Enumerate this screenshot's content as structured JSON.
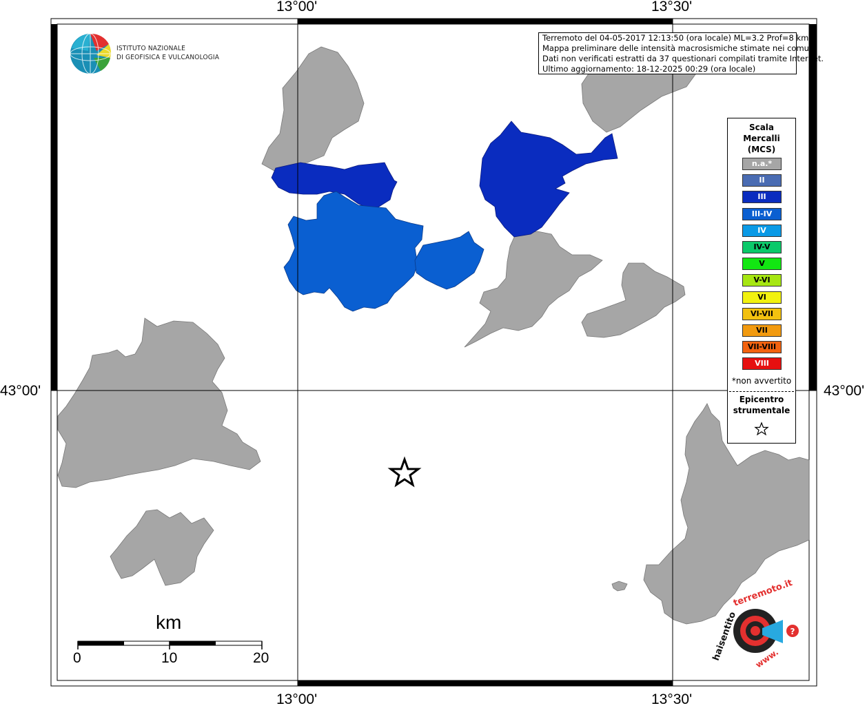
{
  "coordinates": {
    "lon_top_left": "13°00'",
    "lon_top_right": "13°30'",
    "lon_bottom_left": "13°00'",
    "lon_bottom_right": "13°30'",
    "lat_left": "43°00'",
    "lat_right": "43°00'"
  },
  "info": {
    "line1": "Terremoto del 04-05-2017 12:13:50 (ora locale) ML=3.2 Prof=8 km",
    "line2": "Mappa preliminare delle intensità macrosismiche stimate nei comuni",
    "line3": "Dati non verificati estratti da 37 questionari compilati tramite Internet.",
    "line4": "Ultimo aggiornamento: 18-12-2025 00:29 (ora locale)"
  },
  "logo": {
    "line1": "ISTITUTO NAZIONALE",
    "line2": "DI GEOFISICA E VULCANOLOGIA"
  },
  "legend": {
    "title_line1": "Scala",
    "title_line2": "Mercalli",
    "title_line3": "(MCS)",
    "items": [
      {
        "label": "n.a.*",
        "color": "#a6a6a6"
      },
      {
        "label": "II",
        "color": "#4a6cb3"
      },
      {
        "label": "III",
        "color": "#0a2cbf"
      },
      {
        "label": "III-IV",
        "color": "#0a5fd1"
      },
      {
        "label": "IV",
        "color": "#0a9ae6"
      },
      {
        "label": "IV-V",
        "color": "#0bc96a"
      },
      {
        "label": "V",
        "color": "#12e612"
      },
      {
        "label": "V-VI",
        "color": "#a6e612"
      },
      {
        "label": "VI",
        "color": "#f2f20f"
      },
      {
        "label": "VI-VII",
        "color": "#f2c10f"
      },
      {
        "label": "VII",
        "color": "#f29a0f"
      },
      {
        "label": "VII-VIII",
        "color": "#f2620f"
      },
      {
        "label": "VIII",
        "color": "#e61010"
      }
    ],
    "note": "*non avvertito",
    "epicenter_line1": "Epicentro",
    "epicenter_line2": "strumentale"
  },
  "scale_bar": {
    "unit": "km",
    "ticks": [
      "0",
      "10",
      "20"
    ]
  },
  "colors": {
    "not_available": "#a6a6a6",
    "intensity_III": "#0a2cbf",
    "intensity_III_IV": "#0a5fd1"
  },
  "watermark": {
    "text": "www.haisentitoilterremoto.it"
  }
}
